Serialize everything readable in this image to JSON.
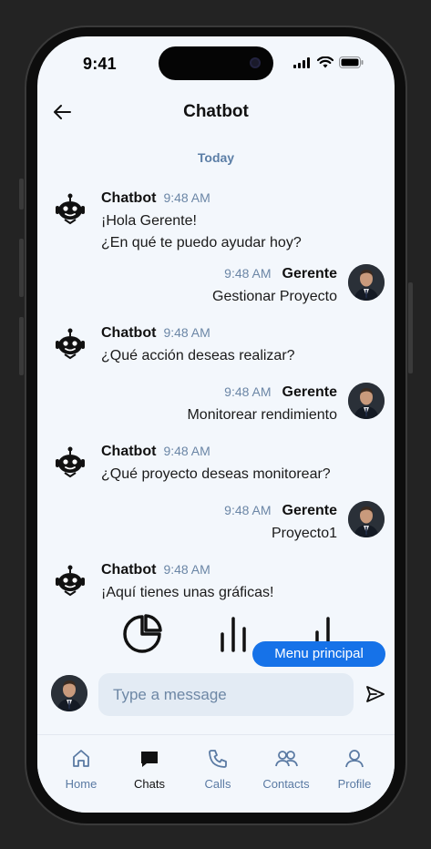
{
  "status": {
    "time": "9:41"
  },
  "header": {
    "title": "Chatbot"
  },
  "date_divider": "Today",
  "messages": [
    {
      "sender": "Chatbot",
      "time": "9:48 AM",
      "lines": [
        "¡Hola Gerente!",
        "¿En qué te puedo ayudar hoy?"
      ]
    },
    {
      "sender": "Gerente",
      "time": "9:48 AM",
      "lines": [
        "Gestionar Proyecto"
      ]
    },
    {
      "sender": "Chatbot",
      "time": "9:48 AM",
      "lines": [
        "¿Qué acción deseas realizar?"
      ]
    },
    {
      "sender": "Gerente",
      "time": "9:48 AM",
      "lines": [
        "Monitorear rendimiento"
      ]
    },
    {
      "sender": "Chatbot",
      "time": "9:48 AM",
      "lines": [
        "¿Qué proyecto deseas monitorear?"
      ]
    },
    {
      "sender": "Gerente",
      "time": "9:48 AM",
      "lines": [
        "Proyecto1"
      ]
    },
    {
      "sender": "Chatbot",
      "time": "9:48 AM",
      "lines": [
        "¡Aquí tienes unas gráficas!"
      ]
    }
  ],
  "chart_icons": [
    "pie-chart-icon",
    "bar-chart-icon",
    "signal-bars-icon"
  ],
  "menu_button": "Menu principal",
  "composer": {
    "placeholder": "Type a message"
  },
  "tabs": [
    {
      "label": "Home",
      "icon": "home-icon",
      "active": false
    },
    {
      "label": "Chats",
      "icon": "chat-icon",
      "active": true
    },
    {
      "label": "Calls",
      "icon": "phone-icon",
      "active": false
    },
    {
      "label": "Contacts",
      "icon": "contacts-icon",
      "active": false
    },
    {
      "label": "Profile",
      "icon": "profile-icon",
      "active": false
    }
  ],
  "colors": {
    "accent": "#1672e8",
    "background": "#f3f7fc",
    "muted": "#6b86a6"
  }
}
